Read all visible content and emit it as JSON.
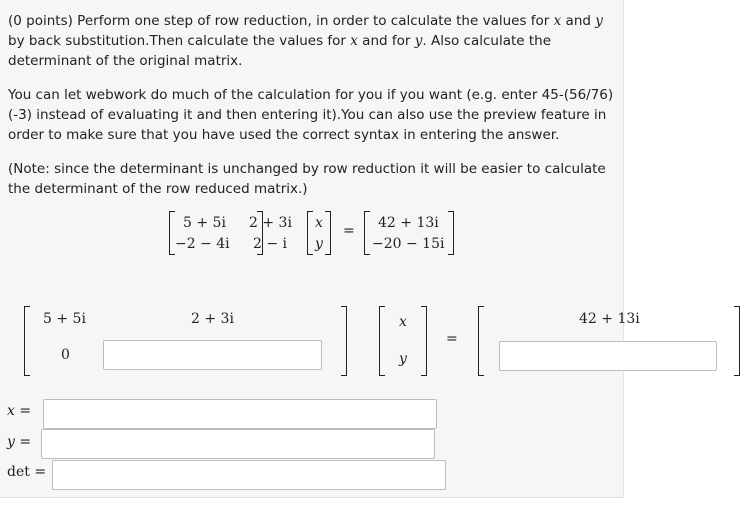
{
  "problem": {
    "points": "(0 points)",
    "para1_a": " Perform one step of row reduction, in order to calculate the values for ",
    "var_x": "x",
    "para1_and": " and ",
    "var_y": "y",
    "para1_b": " by back substitution.Then calculate the values for ",
    "para1_and2": " and for ",
    "para1_c": ". Also calculate the determinant of the original matrix.",
    "para2": "You can let webwork do much of the calculation for you if you want (e.g. enter 45-(56/76)(-3) instead of evaluating it and then entering it).You can also use the preview feature in order to make sure that you have used the correct syntax in entering the answer.",
    "para3": "(Note: since the determinant is unchanged by row reduction it will be easier to calculate the determinant of the row reduced matrix.)"
  },
  "system": {
    "a11": "5 + 5i",
    "a12": "2 + 3i",
    "a21": "−2 − 4i",
    "a22": "2 − i",
    "x": "x",
    "y": "y",
    "equals": "=",
    "b1": "42 + 13i",
    "b2": "−20 − 15i"
  },
  "reduced": {
    "a11": "5 + 5i",
    "a12": "2 + 3i",
    "a21": "0",
    "x": "x",
    "y": "y",
    "equals": "=",
    "b1": "42 + 13i",
    "a22_value": "",
    "b2_value": ""
  },
  "answers": {
    "x_label": "x",
    "y_label": "y",
    "det_label": "det",
    "eq": "=",
    "x_value": "",
    "y_value": "",
    "det_value": ""
  }
}
